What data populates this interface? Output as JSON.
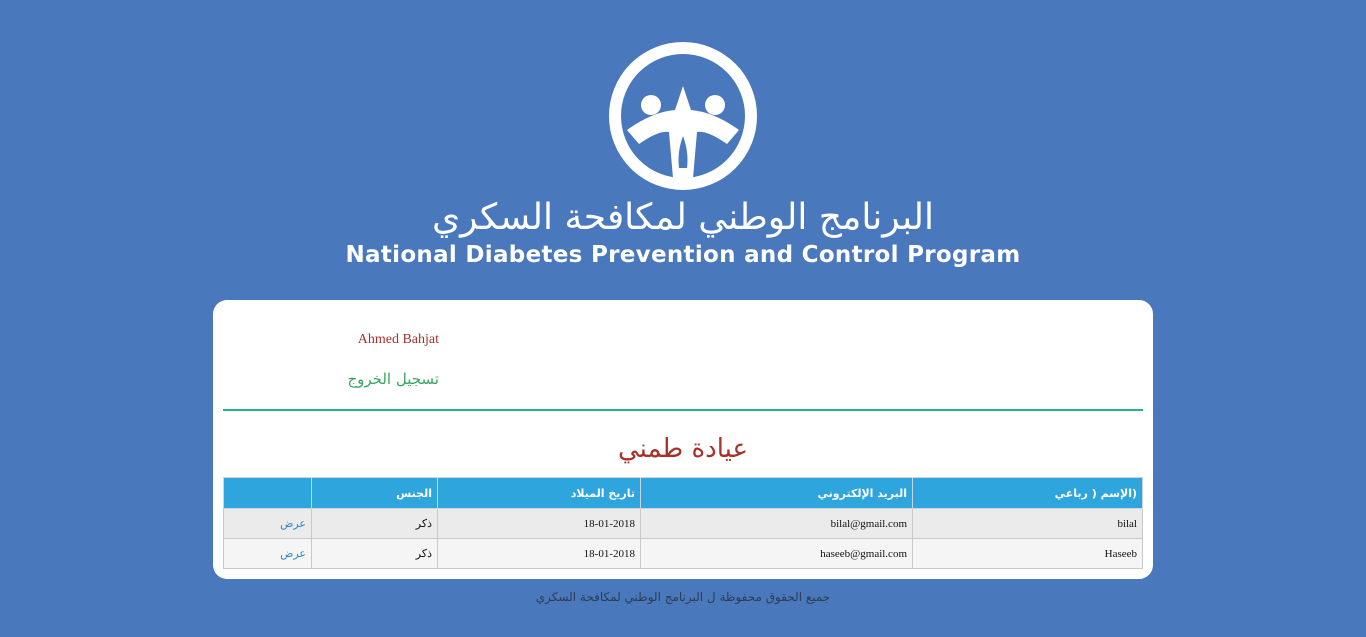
{
  "header": {
    "org_name_ar": "البرنامج الوطني لمكافحة السكري",
    "org_name_en": "National Diabetes Prevention and Control Program",
    "logo_icon": "diabetes-program-logo"
  },
  "user": {
    "name": "Ahmed Bahjat",
    "logout_label": "تسجيل الخروج"
  },
  "page": {
    "title": "عيادة طمني"
  },
  "table": {
    "columns": [
      "(الإسم ( رباعي",
      "البريد الإلكتروني",
      "تاريخ الميلاد",
      "الجنس",
      ""
    ],
    "rows": [
      {
        "name": "bilal",
        "email": "bilal@gmail.com",
        "dob": "18-01-2018",
        "gender": "ذكر",
        "action": "عرض"
      },
      {
        "name": "Haseeb",
        "email": "haseeb@gmail.com",
        "dob": "18-01-2018",
        "gender": "ذكر",
        "action": "عرض"
      }
    ]
  },
  "footer": {
    "text": "جميع الحقوق محفوظة ل البرنامج الوطني لمكافحة السكري"
  },
  "colors": {
    "background": "#4a78bc",
    "accent_red": "#a8322a",
    "accent_green": "#3aa563",
    "table_header": "#2ea5dc",
    "divider": "#22b58a"
  }
}
